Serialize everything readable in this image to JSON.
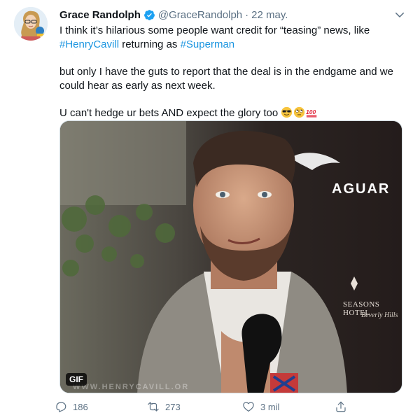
{
  "tweet": {
    "author_name": "Grace Randolph",
    "handle": "@GraceRandolph",
    "separator": "·",
    "date": "22 may.",
    "line1_pre": "I think it’s hilarious some people want credit for “teasing” news, like",
    "tag1": "#HenryCavill",
    "line2_mid": " returning as ",
    "tag2": "#Superman",
    "para2": "but only I have the guts to report that the deal is in the endgame and we could hear as early as next week.",
    "para3": "U can't hedge ur bets AND expect the glory too ",
    "emojis": [
      "sunglasses-emoji",
      "rolling-eyes-emoji",
      "hundred-points-emoji"
    ]
  },
  "media": {
    "gif_badge": "GIF",
    "watermark": "WWW.HENRYCAVILL.OR",
    "brand_text": "AGUAR",
    "hotel_line1": "SEASONS HOTEL",
    "hotel_line2": "Beverly Hills"
  },
  "actions": {
    "reply_count": "186",
    "retweet_count": "273",
    "like_count": "3 mil"
  },
  "colors": {
    "link": "#1b95e0",
    "verified": "#1da1f2",
    "muted": "#5b7083",
    "text": "#0f1419"
  }
}
